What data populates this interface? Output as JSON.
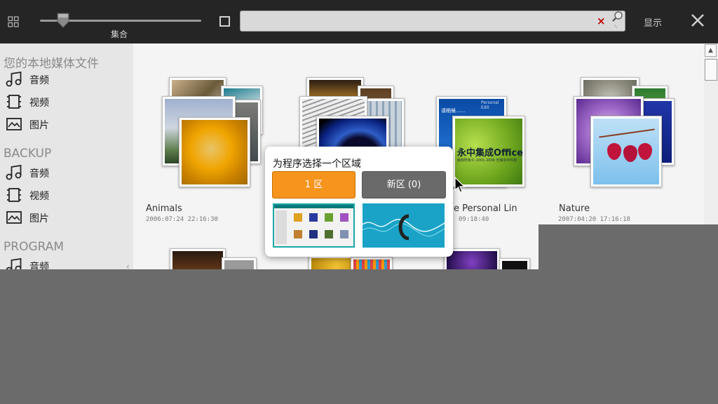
{
  "toolbar": {
    "grid_icon": "grid-view-icon",
    "slider_label": "集合",
    "slider_value_fraction": 0.14,
    "search_placeholder": "",
    "clear_symbol": "×",
    "display_label": "显示",
    "close_icon": "close-icon"
  },
  "sidebar": {
    "sections": [
      {
        "title": "您的本地媒体文件",
        "items": [
          {
            "label": "音频",
            "icon": "music-icon"
          },
          {
            "label": "视频",
            "icon": "film-icon"
          },
          {
            "label": "图片",
            "icon": "picture-icon"
          }
        ]
      },
      {
        "title": "BACKUP",
        "items": [
          {
            "label": "音频",
            "icon": "music-icon"
          },
          {
            "label": "视频",
            "icon": "film-icon"
          },
          {
            "label": "图片",
            "icon": "picture-icon"
          }
        ]
      },
      {
        "title": "PROGRAM",
        "items": [
          {
            "label": "音频",
            "icon": "music-icon"
          }
        ]
      }
    ],
    "collapse_symbol": "‹"
  },
  "collections": [
    {
      "name": "Animals",
      "date": "2006:07:24 22:16:30"
    },
    {
      "name": "",
      "date": ""
    },
    {
      "name": "e Personal Lin",
      "date": "09:18:40"
    },
    {
      "name": "Nature",
      "date": "2007:04:20 17:16:18"
    }
  ],
  "office_text": {
    "top": "Personal Edit",
    "label": "请稍候......",
    "brand": "永中集成Office",
    "sub": "版权所有© 2001-2006  无锡永中科技"
  },
  "dialog": {
    "title": "为程序选择一个区域",
    "zone_button": "1 区",
    "new_zone_button": "新区 (0)"
  },
  "colors": {
    "accent": "#f7941d",
    "topbar": "#252525",
    "sidebar": "#e6e6e6",
    "dim": "#6b6b6b"
  }
}
